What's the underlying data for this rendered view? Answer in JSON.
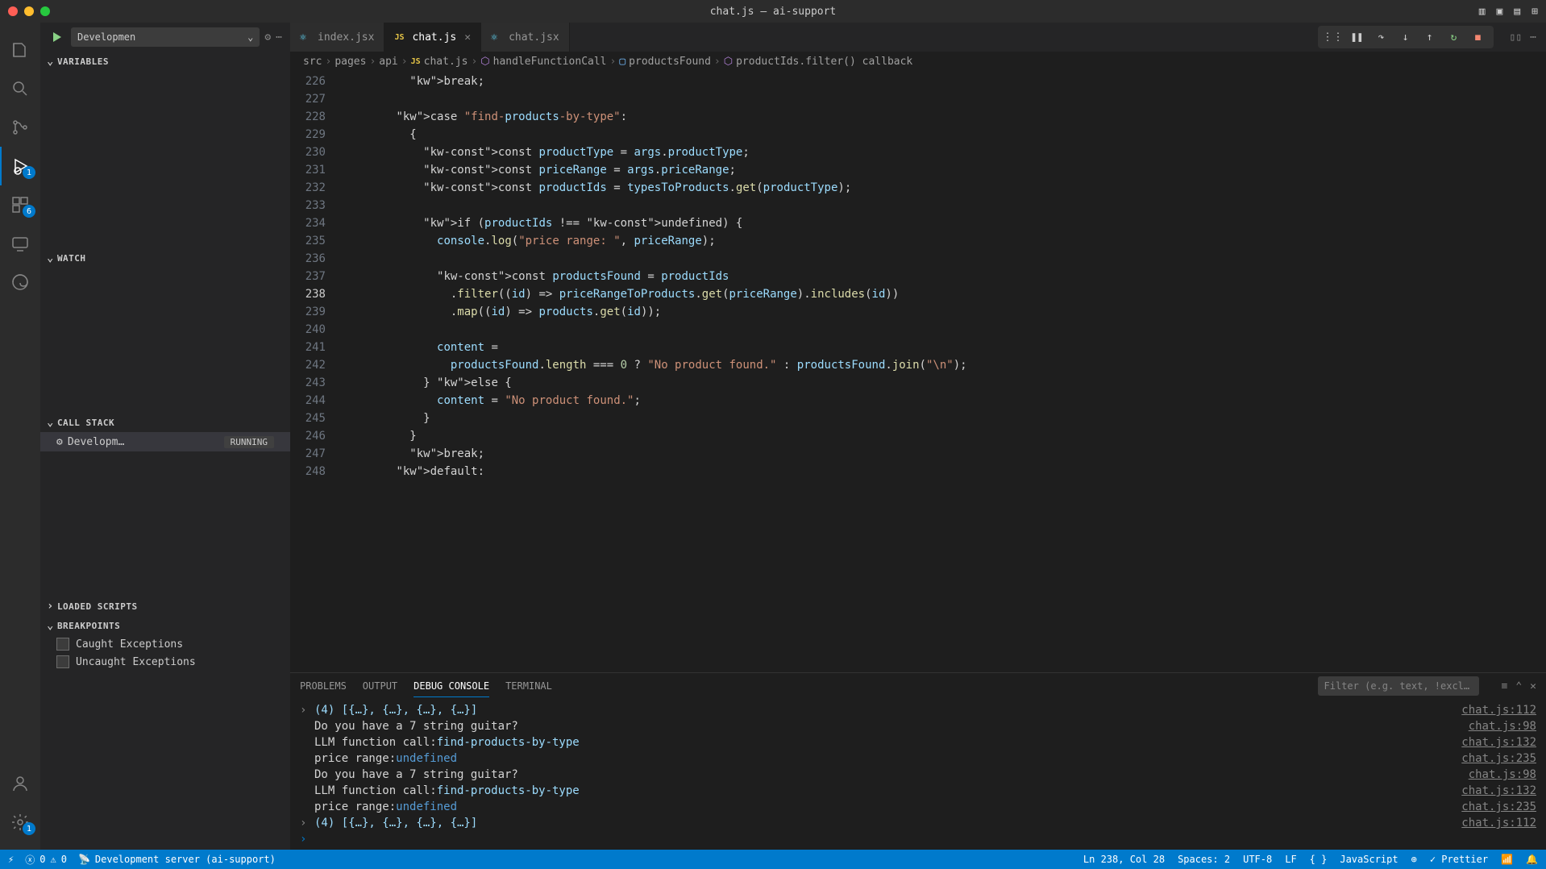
{
  "window": {
    "title": "chat.js — ai-support"
  },
  "debug_config": {
    "label": "Developmen"
  },
  "sidebar": {
    "variables": "VARIABLES",
    "watch": "WATCH",
    "callstack": "CALL STACK",
    "callstack_item": "Developm…",
    "callstack_status": "RUNNING",
    "loaded_scripts": "LOADED SCRIPTS",
    "breakpoints": "BREAKPOINTS",
    "bp_caught": "Caught Exceptions",
    "bp_uncaught": "Uncaught Exceptions"
  },
  "activity": {
    "debug_badge": "1",
    "ext_badge": "6",
    "settings_badge": "1"
  },
  "tabs": [
    {
      "label": "index.jsx",
      "icon": "react",
      "active": false
    },
    {
      "label": "chat.js",
      "icon": "js",
      "active": true
    },
    {
      "label": "chat.jsx",
      "icon": "react",
      "active": false
    }
  ],
  "breadcrumb": {
    "p0": "src",
    "p1": "pages",
    "p2": "api",
    "p3": "chat.js",
    "p4": "handleFunctionCall",
    "p5": "productsFound",
    "p6": "productIds.filter() callback"
  },
  "code": {
    "start": 226,
    "lines": [
      "          break;",
      "",
      "        case \"find-products-by-type\":",
      "          {",
      "            const productType = args.productType;",
      "            const priceRange = args.priceRange;",
      "            const productIds = typesToProducts.get(productType);",
      "",
      "            if (productIds !== undefined) {",
      "              console.log(\"price range: \", priceRange);",
      "",
      "              const productsFound = productIds",
      "                .filter((id) => priceRangeToProducts.get(priceRange).includes(id))",
      "                .map((id) => products.get(id));",
      "",
      "              content =",
      "                productsFound.length === 0 ? \"No product found.\" : productsFound.join(\"\\n\");",
      "            } else {",
      "              content = \"No product found.\";",
      "            }",
      "          }",
      "          break;",
      "        default:"
    ],
    "current_line": 238
  },
  "panel": {
    "tabs": {
      "problems": "PROBLEMS",
      "output": "OUTPUT",
      "debug": "DEBUG CONSOLE",
      "terminal": "TERMINAL"
    },
    "filter_placeholder": "Filter (e.g. text, !excl…"
  },
  "console": [
    {
      "chev": true,
      "text": "(4) [{…}, {…}, {…}, {…}]",
      "cls": "console-text",
      "link": "chat.js:112"
    },
    {
      "text": "Do you have a 7 string guitar?",
      "cls": "console-log",
      "link": "chat.js:98"
    },
    {
      "html": "<span class='console-log'>LLM function call:  </span><span class='console-text'>find-products-by-type</span>",
      "link": "chat.js:132"
    },
    {
      "html": "<span class='console-log'>price range:  </span><span class='console-undef'>undefined</span>",
      "link": "chat.js:235"
    },
    {
      "text": "Do you have a 7 string guitar?",
      "cls": "console-log",
      "link": "chat.js:98"
    },
    {
      "html": "<span class='console-log'>LLM function call:  </span><span class='console-text'>find-products-by-type</span>",
      "link": "chat.js:132"
    },
    {
      "html": "<span class='console-log'>price range:  </span><span class='console-undef'>undefined</span>",
      "link": "chat.js:235"
    },
    {
      "chev": true,
      "text": "(4) [{…}, {…}, {…}, {…}]",
      "cls": "console-text",
      "link": "chat.js:112"
    }
  ],
  "statusbar": {
    "errors": "0",
    "warnings": "0",
    "server": "Development server (ai-support)",
    "cursor": "Ln 238, Col 28",
    "spaces": "Spaces: 2",
    "encoding": "UTF-8",
    "eol": "LF",
    "lang": "JavaScript",
    "prettier": "Prettier"
  }
}
